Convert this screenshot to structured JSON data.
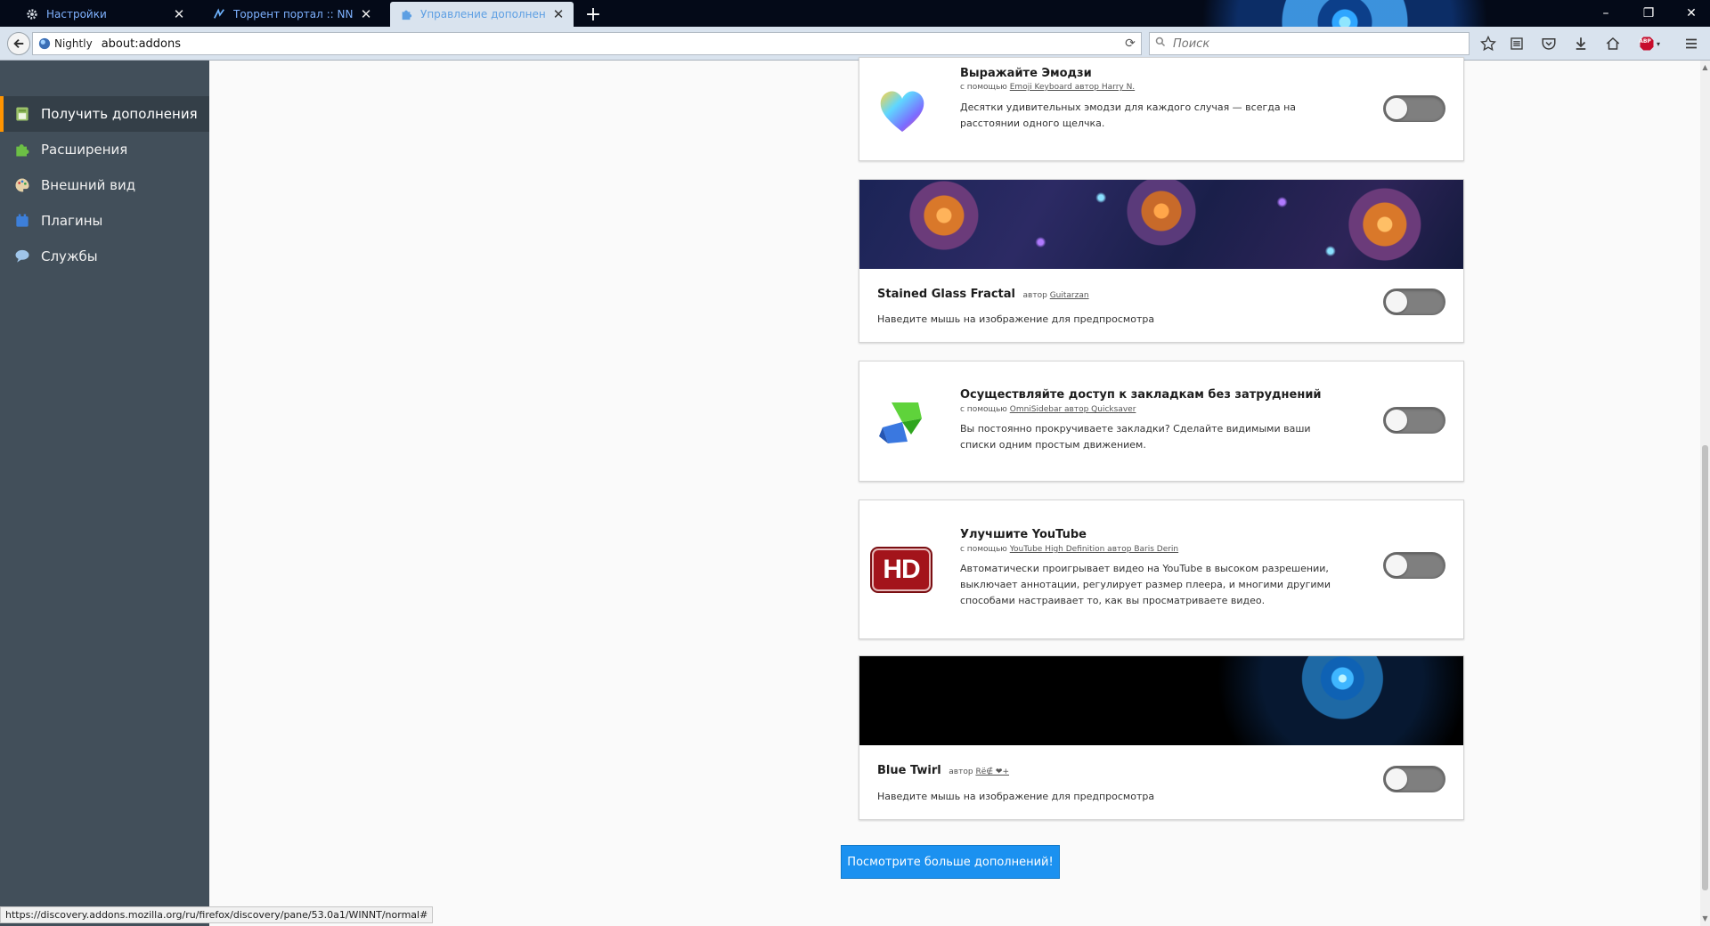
{
  "window": {
    "tabs": [
      {
        "title": "Настройки",
        "icon": "gear-icon",
        "active": false
      },
      {
        "title": "Торрент портал :: NNM-Club",
        "icon": "site-favicon",
        "active": false
      },
      {
        "title": "Управление дополнениями",
        "icon": "puzzle-icon",
        "active": true
      }
    ],
    "new_tab_glyph": "+",
    "controls": {
      "minimize": "–",
      "maximize": "❐",
      "close": "✕"
    }
  },
  "toolbar": {
    "identity_label": "Nightly",
    "url": "about:addons",
    "search_placeholder": "Поиск",
    "buttons": [
      "bookmark-star-icon",
      "reader-list-icon",
      "pocket-icon",
      "download-icon",
      "home-icon",
      "adblock-icon",
      "menu-icon"
    ],
    "adblock_label": "ABP"
  },
  "sidebar": {
    "items": [
      {
        "label": "Получить дополнения",
        "icon": "get-addons-icon",
        "selected": true
      },
      {
        "label": "Расширения",
        "icon": "puzzle-icon",
        "selected": false
      },
      {
        "label": "Внешний вид",
        "icon": "palette-icon",
        "selected": false
      },
      {
        "label": "Плагины",
        "icon": "plugin-block-icon",
        "selected": false
      },
      {
        "label": "Службы",
        "icon": "chat-bubble-icon",
        "selected": false
      }
    ]
  },
  "addons": [
    {
      "kind": "extension",
      "heading": "Выражайте Эмодзи",
      "via": "с помощью",
      "name": "Emoji Keyboard автор Harry N.",
      "description": "Десятки удивительных эмодзи для каждого случая — всегда на расстоянии одного щелчка.",
      "icon": "emoji-heart-icon",
      "enabled": false
    },
    {
      "kind": "theme",
      "name": "Stained Glass Fractal",
      "author_prefix": "автор",
      "author": "Guitarzan",
      "description": "Наведите мышь на изображение для предпросмотра",
      "banner": "stained-glass-fractal",
      "enabled": false
    },
    {
      "kind": "extension",
      "heading": "Осуществляйте доступ к закладкам без затруднений",
      "via": "с помощью",
      "name": "OmniSidebar автор Quicksaver",
      "description": "Вы постоянно прокручиваете закладки? Сделайте видимыми ваши списки одним простым движением.",
      "icon": "omnisidebar-icon",
      "enabled": false
    },
    {
      "kind": "extension",
      "heading": "Улучшите YouTube",
      "via": "с помощью",
      "name": "YouTube High Definition автор Baris Derin",
      "description": "Автоматически проигрывает видео на YouTube в высоком разрешении, выключает аннотации, регулирует размер плеера, и многими другими способами настраивает то, как вы просматриваете видео.",
      "icon": "hd-badge-icon",
      "icon_text": "HD",
      "enabled": false
    },
    {
      "kind": "theme",
      "name": "Blue Twirl",
      "author_prefix": "автор",
      "author": "Rё∉ ❤+",
      "description": "Наведите мышь на изображение для предпросмотра",
      "banner": "blue-twirl",
      "enabled": false
    }
  ],
  "more_button": "Посмотрите больше дополнений!",
  "status_url": "https://discovery.addons.mozilla.org/ru/firefox/discovery/pane/53.0a1/WINNT/normal#",
  "colors": {
    "sidebar_bg": "#424f5a",
    "sidebar_selected": "#343f48",
    "accent_orange": "#ff9400",
    "button_blue": "#1b91f0",
    "toggle_off": "#7f7f7f"
  }
}
